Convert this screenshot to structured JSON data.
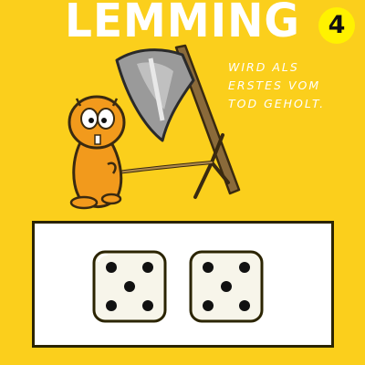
{
  "card": {
    "title": "LEMMING",
    "number": "4",
    "caption_lines": [
      "WIRD ALS",
      "ERSTES VOM",
      "TOD GEHOLT."
    ],
    "background_color": "#fbcf1c"
  },
  "dice": [
    {
      "value": 5
    },
    {
      "value": 5
    }
  ]
}
